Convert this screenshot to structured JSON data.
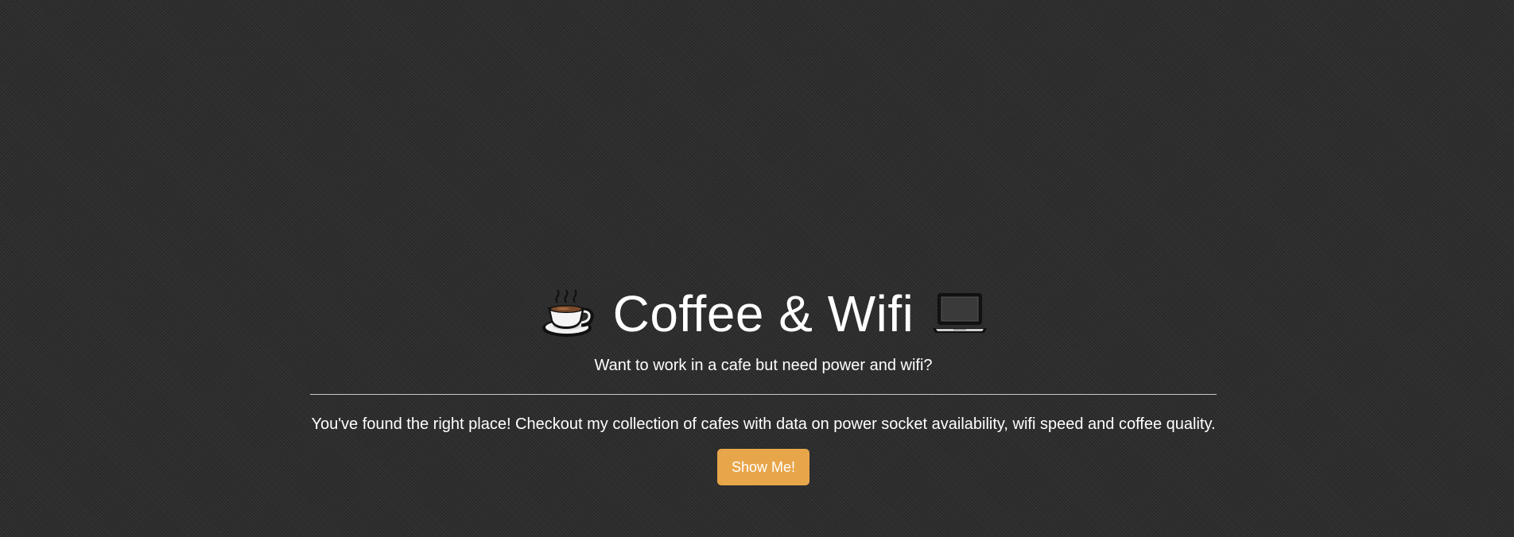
{
  "hero": {
    "title": "Coffee & Wifi",
    "left_icon": "hot-coffee-emoji",
    "right_icon": "laptop-emoji",
    "subtitle": "Want to work in a cafe but need power and wifi?",
    "lead": "You've found the right place! Checkout my collection of cafes with data on power socket availability, wifi speed and coffee quality.",
    "cta_label": "Show Me!"
  },
  "colors": {
    "background": "#2f2f2f",
    "text": "#ffffff",
    "button": "#e8a64a"
  }
}
